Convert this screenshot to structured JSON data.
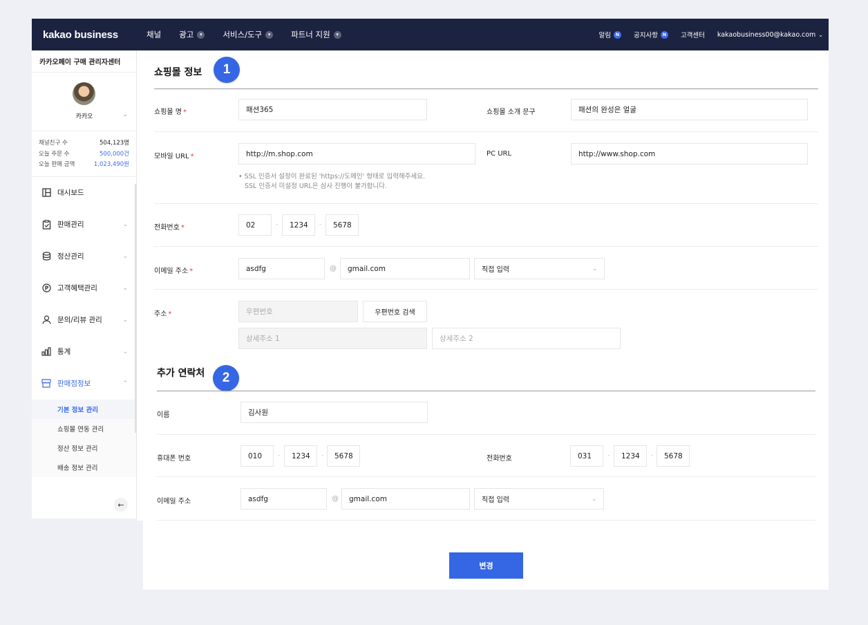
{
  "header": {
    "brand": "kakao business",
    "nav": [
      {
        "label": "채널",
        "has_dropdown": false
      },
      {
        "label": "광고",
        "has_dropdown": true
      },
      {
        "label": "서비스/도구",
        "has_dropdown": true
      },
      {
        "label": "파트너 지원",
        "has_dropdown": true
      }
    ],
    "alerts_label": "알림",
    "notice_label": "공지사항",
    "badge_letter": "N",
    "support_label": "고객센터",
    "account": "kakaobusiness00@kakao.com"
  },
  "sidebar": {
    "title": "카카오페이 구매 관리자센터",
    "profile_name": "카카오",
    "stats": [
      {
        "label": "채널친구 수",
        "value": "504,123명",
        "highlight": false
      },
      {
        "label": "오늘 주문 수",
        "value": "500,000건",
        "highlight": true
      },
      {
        "label": "오늘 판매 금액",
        "value": "1,023,490원",
        "highlight": true
      }
    ],
    "menu": [
      {
        "label": "대시보드",
        "icon": "dashboard-icon",
        "chevron": false,
        "active": false
      },
      {
        "label": "판매관리",
        "icon": "clipboard-icon",
        "chevron": true,
        "active": false
      },
      {
        "label": "정산관리",
        "icon": "database-icon",
        "chevron": true,
        "active": false
      },
      {
        "label": "고객혜택관리",
        "icon": "point-icon",
        "chevron": true,
        "active": false
      },
      {
        "label": "문의/리뷰 관리",
        "icon": "person-icon",
        "chevron": true,
        "active": false
      },
      {
        "label": "통계",
        "icon": "bar-chart-icon",
        "chevron": true,
        "active": false
      },
      {
        "label": "판매점정보",
        "icon": "store-icon",
        "chevron": true,
        "active": true
      }
    ],
    "submenu": [
      {
        "label": "기본 정보 관리",
        "active": true
      },
      {
        "label": "쇼핑몰 연동 관리",
        "active": false
      },
      {
        "label": "정산 정보 관리",
        "active": false
      },
      {
        "label": "배송 정보 관리",
        "active": false
      }
    ]
  },
  "shop": {
    "section_title": "쇼핑몰 정보",
    "badge": "1",
    "shop_name_label": "쇼핑몰 명",
    "shop_name_value": "패션365",
    "intro_label": "쇼핑몰 소개 문구",
    "intro_value": "패션의 완성은 얼굴",
    "mobile_url_label": "모바일 URL",
    "mobile_url_value": "http://m.shop.com",
    "pc_url_label": "PC URL",
    "pc_url_value": "http://www.shop.com",
    "ssl_help_1": "• SSL 인증서 설정이 완료된 'https://도메인' 형태로 입력해주세요.",
    "ssl_help_2": "SSL 인증서 미설정 URL은 심사 진행이 불가합니다.",
    "phone_label": "전화번호",
    "phone": [
      "02",
      "1234",
      "5678"
    ],
    "email_label": "이메일 주소",
    "email_id": "asdfg",
    "email_domain": "gmail.com",
    "email_select": "직접 입력",
    "address_label": "주소",
    "zip_placeholder": "우편번호",
    "zip_search_button": "우편번호 검색",
    "addr1_placeholder": "상세주소 1",
    "addr2_placeholder": "상세주소 2"
  },
  "contact": {
    "section_title": "추가 연락처",
    "badge": "2",
    "name_label": "이름",
    "name_value": "김사원",
    "mobile_label": "휴대폰 번호",
    "mobile": [
      "010",
      "1234",
      "5678"
    ],
    "phone_label": "전화번호",
    "phone": [
      "031",
      "1234",
      "5678"
    ],
    "email_label": "이메일 주소",
    "email_id": "asdfg",
    "email_domain": "gmail.com",
    "email_select": "직접 입력"
  },
  "common": {
    "required_mark": "*",
    "dash": "-",
    "at": "@"
  },
  "submit_label": "변경"
}
